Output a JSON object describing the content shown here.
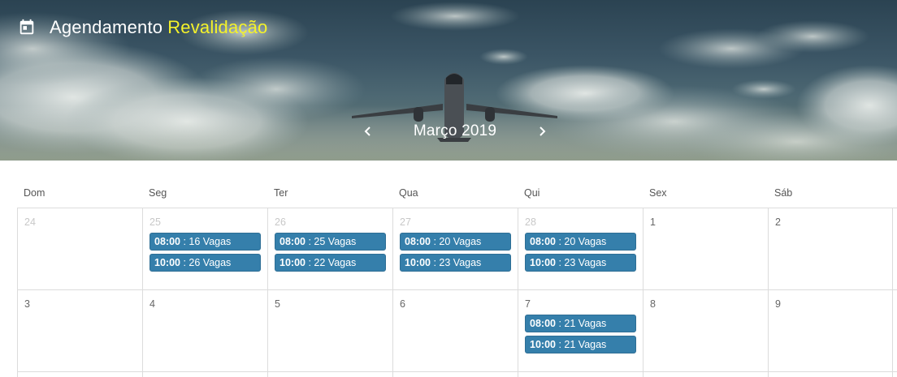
{
  "header": {
    "icon": "calendar-icon",
    "title_main": "Agendamento",
    "title_highlight": "Revalidação",
    "highlight_color": "#f4f22a"
  },
  "nav": {
    "month_label": "Março 2019",
    "prev_icon": "chevron-left-icon",
    "next_icon": "chevron-right-icon"
  },
  "calendar": {
    "weekdays": [
      "Dom",
      "Seg",
      "Ter",
      "Qua",
      "Qui",
      "Sex",
      "Sáb"
    ],
    "slot_color": "#357fab",
    "weeks": [
      {
        "days": [
          {
            "num": "24",
            "outside": true,
            "slots": []
          },
          {
            "num": "25",
            "outside": true,
            "slots": [
              {
                "time": "08:00",
                "label": " : 16 Vagas"
              },
              {
                "time": "10:00",
                "label": " : 26 Vagas"
              }
            ]
          },
          {
            "num": "26",
            "outside": true,
            "slots": [
              {
                "time": "08:00",
                "label": " : 25 Vagas"
              },
              {
                "time": "10:00",
                "label": " : 22 Vagas"
              }
            ]
          },
          {
            "num": "27",
            "outside": true,
            "slots": [
              {
                "time": "08:00",
                "label": " : 20 Vagas"
              },
              {
                "time": "10:00",
                "label": " : 23 Vagas"
              }
            ]
          },
          {
            "num": "28",
            "outside": true,
            "slots": [
              {
                "time": "08:00",
                "label": " : 20 Vagas"
              },
              {
                "time": "10:00",
                "label": " : 23 Vagas"
              }
            ]
          },
          {
            "num": "1",
            "outside": false,
            "slots": []
          },
          {
            "num": "2",
            "outside": false,
            "slots": []
          }
        ]
      },
      {
        "days": [
          {
            "num": "3",
            "outside": false,
            "slots": []
          },
          {
            "num": "4",
            "outside": false,
            "slots": []
          },
          {
            "num": "5",
            "outside": false,
            "slots": []
          },
          {
            "num": "6",
            "outside": false,
            "slots": []
          },
          {
            "num": "7",
            "outside": false,
            "slots": [
              {
                "time": "08:00",
                "label": " : 21 Vagas"
              },
              {
                "time": "10:00",
                "label": " : 21 Vagas"
              }
            ]
          },
          {
            "num": "8",
            "outside": false,
            "slots": []
          },
          {
            "num": "9",
            "outside": false,
            "slots": []
          }
        ]
      }
    ]
  }
}
